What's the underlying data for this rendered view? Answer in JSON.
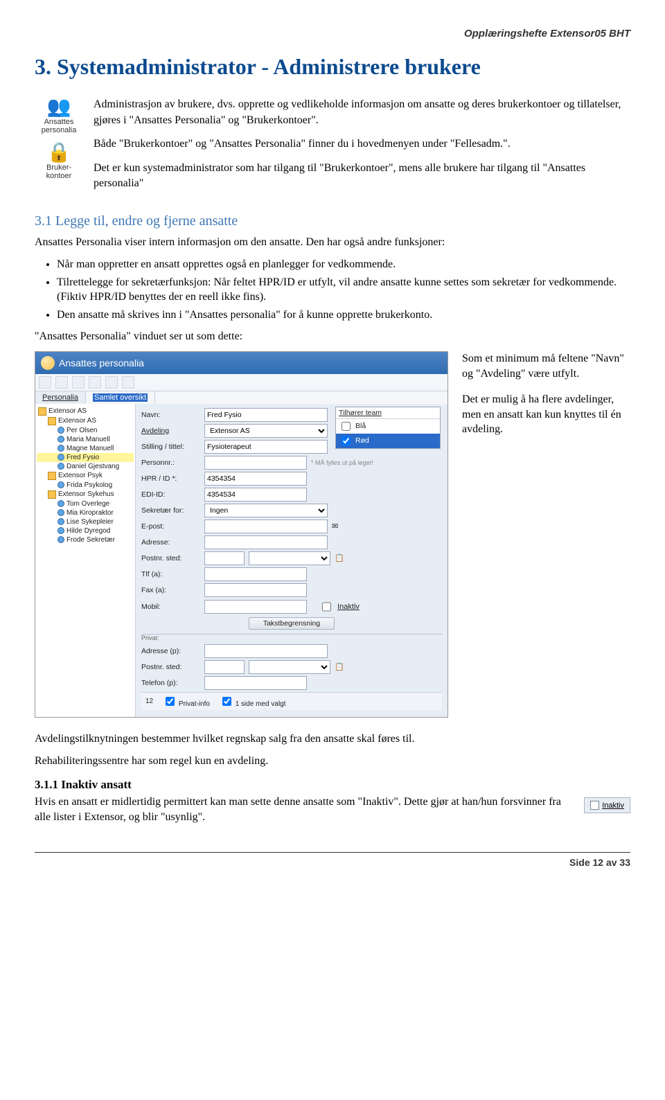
{
  "doc_header": "Opplæringshefte Extensor05 BHT",
  "h1": "3. Systemadministrator - Administrere brukere",
  "sidebar_icons": {
    "personalia_label": "Ansattes personalia",
    "brukerkontoer_label": "Bruker-kontoer"
  },
  "intro": {
    "p1": "Administrasjon av brukere, dvs. opprette og vedlikeholde informasjon om ansatte og deres brukerkontoer og tillatelser, gjøres i \"Ansattes Personalia\" og \"Brukerkontoer\".",
    "p2": "Både \"Brukerkontoer\" og \"Ansattes Personalia\" finner du i hovedmenyen under \"Fellesadm.\".",
    "p3": "Det er kun systemadministrator som har tilgang til \"Brukerkontoer\", mens alle brukere har tilgang til \"Ansattes personalia\""
  },
  "h2": "3.1 Legge til, endre og fjerne ansatte",
  "body": {
    "p1": "Ansattes Personalia viser intern informasjon om den ansatte. Den har også andre funksjoner:",
    "b1": "Når man oppretter en ansatt opprettes også en planlegger for vedkommende.",
    "b2": "Tilrettelegge for sekretærfunksjon: Når feltet HPR/ID er utfylt, vil andre ansatte kunne settes som sekretær for vedkommende. (Fiktiv HPR/ID benyttes der en reell ikke fins).",
    "b3": "Den ansatte må skrives inn i \"Ansattes personalia\" for å kunne opprette brukerkonto.",
    "p2": "\"Ansattes Personalia\" vinduet ser ut som dette:"
  },
  "screenshot": {
    "title": "Ansattes personalia",
    "tabs": {
      "t1": "Personalia",
      "t2": "Samlet oversikt"
    },
    "tree": [
      {
        "lvl": 0,
        "cls": "org",
        "txt": "Extensor AS"
      },
      {
        "lvl": 1,
        "cls": "org",
        "txt": "Extensor AS"
      },
      {
        "lvl": 2,
        "cls": "pers",
        "txt": "Per Olsen"
      },
      {
        "lvl": 2,
        "cls": "pers",
        "txt": "Maria Manuell"
      },
      {
        "lvl": 2,
        "cls": "pers",
        "txt": "Magne Manuell"
      },
      {
        "lvl": 2,
        "cls": "pers sel",
        "txt": "Fred Fysio"
      },
      {
        "lvl": 2,
        "cls": "pers",
        "txt": "Daniel Gjestvang"
      },
      {
        "lvl": 1,
        "cls": "org",
        "txt": "Extensor Psyk"
      },
      {
        "lvl": 2,
        "cls": "pers",
        "txt": "Frida Psykolog"
      },
      {
        "lvl": 1,
        "cls": "org",
        "txt": "Extensor Sykehus"
      },
      {
        "lvl": 2,
        "cls": "pers",
        "txt": "Tom Overlege"
      },
      {
        "lvl": 2,
        "cls": "pers",
        "txt": "Mia Kiropraktor"
      },
      {
        "lvl": 2,
        "cls": "pers",
        "txt": "Lise Sykepleier"
      },
      {
        "lvl": 2,
        "cls": "pers",
        "txt": "Hilde Dyregod"
      },
      {
        "lvl": 2,
        "cls": "pers",
        "txt": "Frode Sekretær"
      }
    ],
    "form": {
      "navn_l": "Navn:",
      "navn_v": "Fred Fysio",
      "avd_l": "Avdeling",
      "avd_v": "Extensor AS",
      "stil_l": "Stilling / tittel:",
      "stil_v": "Fysioterapeut",
      "pnr_l": "Personnr.:",
      "pnr_hint": "* MÅ fylles ut på leger!",
      "hpr_l": "HPR / ID *:",
      "hpr_v": "4354354",
      "edi_l": "EDI-ID:",
      "edi_v": "4354534",
      "sek_l": "Sekretær for:",
      "sek_v": "Ingen",
      "epost_l": "E-post:",
      "adr_l": "Adresse:",
      "post_l": "Postnr. sted:",
      "tlf_l": "Tlf (a):",
      "fax_l": "Fax (a):",
      "mobil_l": "Mobil:",
      "inaktiv": "Inaktiv",
      "privat_hdr": "Privat:",
      "adrp_l": "Adresse (p):",
      "postp_l": "Postnr. sted:",
      "tlfp_l": "Telefon (p):",
      "btn_takst": "Takstbegrensning",
      "team_h": "Tilhører team",
      "team_1": "Blå",
      "team_2": "Rød",
      "foot_n": "12",
      "foot_1": "Privat-info",
      "foot_2": "1 side med valgt"
    }
  },
  "notes": {
    "p1": "Som et minimum må feltene \"Navn\" og \"Avdeling\" være utfylt.",
    "p2": "Det er mulig å ha flere avdelinger, men en ansatt kan kun knyttes til én avdeling."
  },
  "after": {
    "p1": "Avdelingstilknytningen bestemmer hvilket regnskap salg fra den ansatte skal føres til.",
    "p2": "Rehabiliteringssentre har som regel kun en avdeling."
  },
  "h3": "3.1.1 Inaktiv ansatt",
  "inaktiv_p": "Hvis en ansatt er midlertidig permittert kan man sette denne ansatte som \"Inaktiv\". Dette gjør at han/hun forsvinner fra alle lister i Extensor, og blir \"usynlig\".",
  "inaktiv_label": "Inaktiv",
  "footer": "Side 12 av 33"
}
